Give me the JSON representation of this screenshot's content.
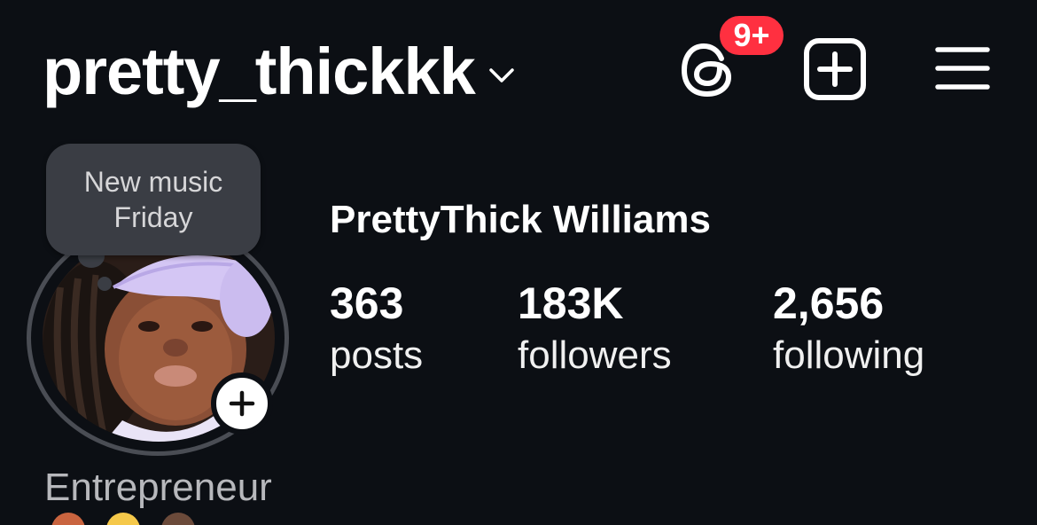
{
  "header": {
    "username": "pretty_thickkk",
    "threads_badge": "9+",
    "icons": {
      "switch_account": "chevron-down-icon",
      "threads": "threads-icon",
      "create": "plus-square-icon",
      "menu": "hamburger-menu-icon"
    }
  },
  "note": {
    "text": "New music Friday"
  },
  "profile": {
    "display_name": "PrettyThick Williams",
    "stats": [
      {
        "value": "363",
        "label": "posts"
      },
      {
        "value": "183K",
        "label": "followers"
      },
      {
        "value": "2,656",
        "label": "following"
      }
    ],
    "bio_category": "Entrepreneur"
  },
  "colors": {
    "background": "#0c0f14",
    "badge": "#ff3040",
    "text": "#ffffff",
    "muted_text": "#b7b8bc",
    "note_bubble": "#3a3d44"
  }
}
